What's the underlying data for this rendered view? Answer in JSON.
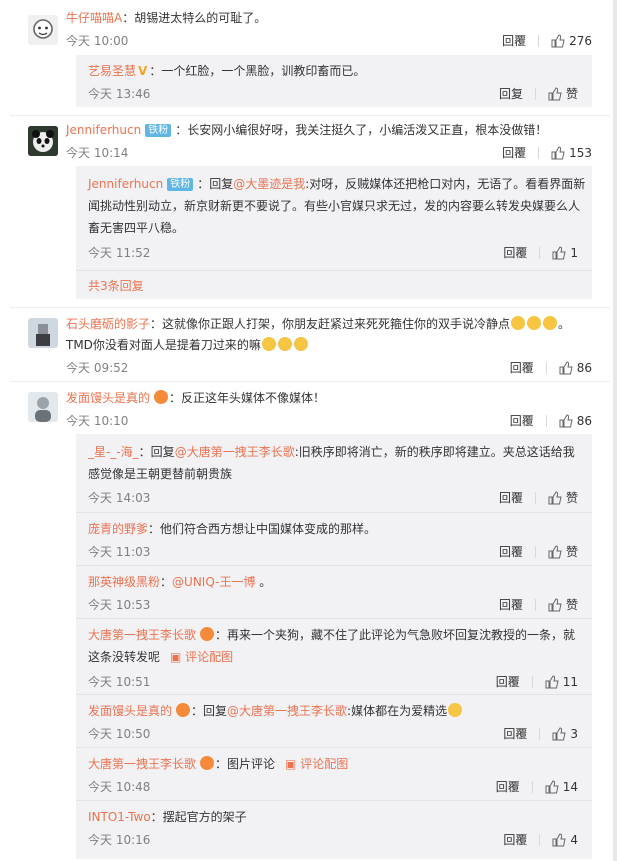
{
  "labels": {
    "reply": "回复",
    "like": "赞"
  },
  "comments": [
    {
      "user": "牛仔喵喵A",
      "sep": "：",
      "text": "胡锡进太特么的可耻了。",
      "time": "今天 10:00",
      "reply": "回覆",
      "likes": "276",
      "replies": [
        {
          "user": "艺易圣慧",
          "sep": "：",
          "text": "一个红脸，一个黑脸，训教印畜而已。",
          "time": "今天 13:46",
          "reply": "回复",
          "likes": "赞"
        }
      ]
    },
    {
      "user": "Jenniferhucn",
      "badge": "铁粉",
      "sep": "：",
      "text": "长安网小编很好呀，我关注挺久了，小编活泼又正直，根本没做错！",
      "time": "今天 10:14",
      "reply": "回覆",
      "likes": "153",
      "replies": [
        {
          "user": "Jenniferhucn",
          "badge": "铁粉",
          "sep": "：回复",
          "mention": "@大墨迹是我",
          "text1": ":对呀，反贼媒体还把枪口对内，无语了。看看界面新",
          "text2": "闻挑动性别动立，新京财新更不要说了。有些小官媒只求无过，发的内容要么转发央媒要么人",
          "text3": "畜无害四平八稳。",
          "time": "今天 11:52",
          "reply": "回覆",
          "likes": "1"
        }
      ],
      "more": "共3条回复"
    },
    {
      "user": "石头磨砺的影子",
      "sep": "：",
      "text1": "这就像你正跟人打架，你朋友赶紧过来死死箍住你的双手说冷静点",
      "text2": "TMD你没看对面人是提着刀过来的嘛",
      "time": "今天 09:52",
      "reply": "回覆",
      "likes": "86"
    },
    {
      "user": "发面馒头是真的",
      "sep": "：",
      "text": "反正这年头媒体不像媒体！",
      "time": "今天 10:10",
      "reply": "回覆",
      "likes": "86",
      "replies": [
        {
          "user": "_星-_-海_",
          "sep": "：回复",
          "mention": "@大唐第一拽王李长歌",
          "text1": ":旧秩序即将消亡，新的秩序即将建立。夹总这话给我",
          "text2": "感觉像是王朝更替前朝贵族",
          "time": "今天 14:03",
          "reply": "回覆",
          "likes": "赞"
        },
        {
          "user": "庞青的野爹",
          "sep": "：",
          "text": "他们符合西方想让中国媒体变成的那样。",
          "time": "今天 11:03",
          "reply": "回覆",
          "likes": "赞"
        },
        {
          "user": "那英神级黑粉",
          "sep": "：",
          "mention": "@UNIQ-王一博",
          "text": " 。",
          "time": "今天 10:53",
          "reply": "回覆",
          "likes": "赞"
        },
        {
          "user": "大唐第一拽王李长歌",
          "sep": "：",
          "text1": "再来一个夹狗，藏不住了此评论为气急败坏回复沈教授的一条，就",
          "text2": "这条没转发呢",
          "pic": "评论配图",
          "time": "今天 10:51",
          "reply": "回覆",
          "likes": "11"
        },
        {
          "user": "发面馒头是真的",
          "sep": "：回复",
          "mention": "@大唐第一拽王李长歌",
          "text": ":媒体都在为爱精选",
          "time": "今天 10:50",
          "reply": "回覆",
          "likes": "3"
        },
        {
          "user": "大唐第一拽王李长歌",
          "sep": "：",
          "text": "图片评论",
          "pic": "评论配图",
          "time": "今天 10:48",
          "reply": "回覆",
          "likes": "14"
        },
        {
          "user": "INTO1-Two",
          "sep": "：",
          "text": "摆起官方的架子",
          "time": "今天 10:16",
          "reply": "回覆",
          "likes": "4"
        }
      ]
    }
  ]
}
